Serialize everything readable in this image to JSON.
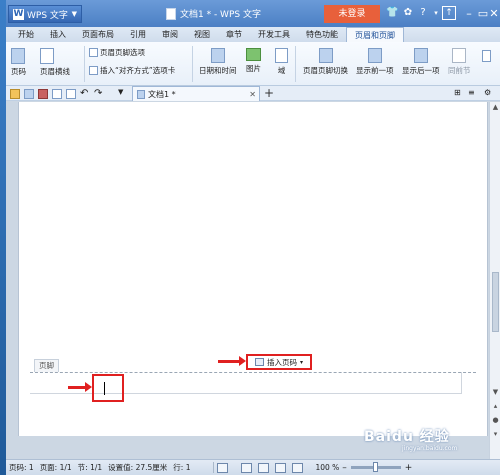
{
  "titlebar": {
    "app_label": "WPS 文字",
    "doc_title": "文档1 * - WPS 文字",
    "login_label": "未登录"
  },
  "menu": {
    "tabs": [
      {
        "label": "开始"
      },
      {
        "label": "插入"
      },
      {
        "label": "页面布局"
      },
      {
        "label": "引用"
      },
      {
        "label": "审阅"
      },
      {
        "label": "视图"
      },
      {
        "label": "章节"
      },
      {
        "label": "开发工具"
      },
      {
        "label": "特色功能"
      },
      {
        "label": "页眉和页脚",
        "active": true
      }
    ]
  },
  "ribbon": {
    "page_number": "页码",
    "header_line": "页眉横线",
    "header_footer_options": "页眉页脚选项",
    "insert_align_tab": "插入“对齐方式”选项卡",
    "datetime": "日期和时间",
    "picture": "图片",
    "field": "域",
    "switch_header_footer": "页眉页脚切换",
    "show_prev": "显示前一项",
    "show_next": "显示后一项",
    "same_as_prev": "同前节"
  },
  "doc_tab": {
    "label": "文档1 *"
  },
  "document": {
    "footer_label": "页脚",
    "insert_page_number_label": "插入页码"
  },
  "status": {
    "page_num": "页码: 1",
    "pages": "页面: 1/1",
    "section": "节: 1/1",
    "set_value": "设置值: 27.5厘米",
    "row": "行: 1",
    "zoom": "100 %",
    "zoom_fraction": 0.5
  },
  "watermark": {
    "brand": "Baidu 经验",
    "url": "jingyan.baidu.com"
  },
  "colors": {
    "accent_red": "#e02020",
    "login_orange": "#e8603b",
    "title_blue": "#4b7fc4"
  }
}
